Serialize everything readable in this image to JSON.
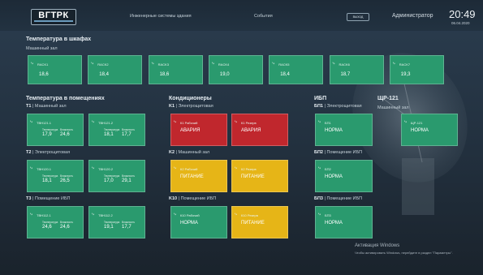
{
  "header": {
    "logo": "ВГТРК",
    "nav": [
      "Инженерные системы здания",
      "События"
    ],
    "logout": "выход",
    "user": "Администратор",
    "time": "20:49",
    "date": "06.04.2020"
  },
  "cabinets": {
    "title": "Температура в шкафах",
    "location": "Машинный зал",
    "cards": [
      {
        "name": "RACK1",
        "value": "18,6"
      },
      {
        "name": "RACK2",
        "value": "18,4"
      },
      {
        "name": "RACK3",
        "value": "18,6"
      },
      {
        "name": "RACK4",
        "value": "19,0"
      },
      {
        "name": "RACK5",
        "value": "18,4"
      },
      {
        "name": "RACK6",
        "value": "18,7"
      },
      {
        "name": "RACK7",
        "value": "19,3"
      }
    ]
  },
  "rooms": {
    "title": "Температура в помещениях",
    "groups": [
      {
        "id": "T1",
        "location": "Машинный зал",
        "cards": [
          {
            "name": "ТВН121.1",
            "v1": "17,9",
            "v2": "24,6"
          },
          {
            "name": "ТВН121.2",
            "v1": "18,1",
            "v2": "17,7"
          }
        ]
      },
      {
        "id": "T2",
        "location": "Электрощитовая",
        "cards": [
          {
            "name": "ТВН120.1",
            "v1": "18,1",
            "v2": "26,5"
          },
          {
            "name": "ТВН120.2",
            "v1": "17,0",
            "v2": "29,1"
          }
        ]
      },
      {
        "id": "T3",
        "location": "Помещение ИБП",
        "cards": [
          {
            "name": "ТВН112.1",
            "v1": "24,6",
            "v2": "24,6"
          },
          {
            "name": "ТВН112.2",
            "v1": "19,1",
            "v2": "17,7"
          }
        ]
      }
    ],
    "cap_temp": "Температура",
    "cap_hum": "Влажность"
  },
  "ac": {
    "title": "Кондиционеры",
    "groups": [
      {
        "id": "K1",
        "location": "Электрощитовая",
        "cards": [
          {
            "name": "К1 Рабочий",
            "state": "АВАРИЯ",
            "color": "#c0272d"
          },
          {
            "name": "К1 Резерв",
            "state": "АВАРИЯ",
            "color": "#c0272d"
          }
        ]
      },
      {
        "id": "K2",
        "location": "Машинный зал",
        "cards": [
          {
            "name": "К2 Рабочий",
            "state": "ПИТАНИЕ",
            "color": "#e6b517"
          },
          {
            "name": "К2 Резерв",
            "state": "ПИТАНИЕ",
            "color": "#e6b517"
          }
        ]
      },
      {
        "id": "K10",
        "location": "Помещение ИБП",
        "cards": [
          {
            "name": "К10 Рабочий",
            "state": "НОРМА",
            "color": "#2a9a6e"
          },
          {
            "name": "К10 Резерв",
            "state": "ПИТАНИЕ",
            "color": "#e6b517"
          }
        ]
      }
    ]
  },
  "ups": {
    "title": "ИБП",
    "groups": [
      {
        "id": "БП1",
        "location": "Электрощитовая",
        "card": {
          "name": "БП1",
          "state": "НОРМА"
        }
      },
      {
        "id": "БП2",
        "location": "Помещение ИБП",
        "card": {
          "name": "БП2",
          "state": "НОРМА"
        }
      },
      {
        "id": "БП3",
        "location": "Помещение ИБП",
        "card": {
          "name": "БП3",
          "state": "НОРМА"
        }
      }
    ]
  },
  "shr": {
    "title": "ЩР-121",
    "location": "Машинный зал",
    "card": {
      "name": "ЩР-121",
      "state": "НОРМА"
    }
  },
  "watermark": {
    "line1": "Активация Windows",
    "line2": "Чтобы активировать Windows, перейдите в раздел \"Параметры\"."
  }
}
